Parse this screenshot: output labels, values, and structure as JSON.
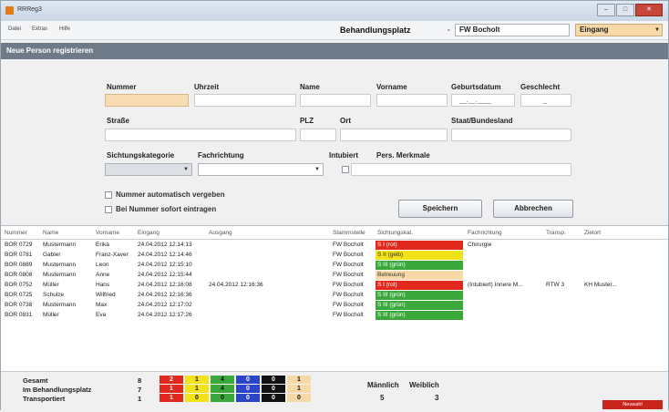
{
  "window": {
    "title": "RRReg3",
    "min": "–",
    "max": "□",
    "close": "✕"
  },
  "menu": {
    "items": [
      "Datei",
      "Extras",
      "Hilfe"
    ]
  },
  "header": {
    "location_label": "Behandlungsplatz",
    "unit": "FW Bocholt",
    "unit_prefix": "- ",
    "view": "Eingang"
  },
  "section": {
    "title": "Neue Person registrieren"
  },
  "form": {
    "labels": {
      "nummer": "Nummer",
      "uhrzeit": "Uhrzeit",
      "name": "Name",
      "vorname": "Vorname",
      "geburtsdatum": "Geburtsdatum",
      "geschlecht": "Geschlecht",
      "strasse": "Straße",
      "plz": "PLZ",
      "ort": "Ort",
      "staat": "Staat/Bundesland",
      "sichtungskategorie": "Sichtungskategorie",
      "fachrichtung": "Fachrichtung",
      "intubiert": "Intubiert",
      "merkmale": "Pers. Merkmale"
    },
    "geburtsdatum_mask": "__.__.____",
    "geschlecht_value": "_",
    "checkbox_auto": "Nummer automatisch vergeben",
    "checkbox_sofort": "Bei Nummer sofort eintragen",
    "save_label": "Speichern",
    "cancel_label": "Abbrechen"
  },
  "table": {
    "columns": [
      "Nummer",
      "Name",
      "Vorname",
      "Eingang",
      "Ausgang",
      "Stammstelle",
      "Sichtungskat.",
      "Fachrichtung",
      "Transp.",
      "Zielort"
    ],
    "rows": [
      [
        "BOR 0729",
        "Mustermann",
        "Erika",
        "24.04.2012 12:14:13",
        "",
        "FW Bocholt",
        "S I (rot)",
        "Chirurgie",
        "",
        ""
      ],
      [
        "BOR 0781",
        "Gabler",
        "Franz-Xaver",
        "24.04.2012 12:14:46",
        "",
        "FW Bocholt",
        "S II (gelb)",
        "",
        "",
        ""
      ],
      [
        "BOR 0889",
        "Mustermann",
        "Leon",
        "24.04.2012 12:15:10",
        "",
        "FW Bocholt",
        "S III (grün)",
        "",
        "",
        ""
      ],
      [
        "BOR 0808",
        "Mustermann",
        "Anne",
        "24.04.2012 12:15:44",
        "",
        "FW Bocholt",
        "Betreuung",
        "",
        "",
        ""
      ],
      [
        "BOR 0752",
        "Müller",
        "Hans",
        "24.04.2012 12:16:08",
        "24.04.2012 12:16:36",
        "FW Bocholt",
        "S I (rot)",
        "(Intubiert) Innere M...",
        "RTW 3",
        "KH Muster..."
      ],
      [
        "BOR 0725",
        "Schulze",
        "Wilfried",
        "24.04.2012 12:16:36",
        "",
        "FW Bocholt",
        "S III (grün)",
        "",
        "",
        ""
      ],
      [
        "BOR 0738",
        "Mustermann",
        "Max",
        "24.04.2012 12:17:02",
        "",
        "FW Bocholt",
        "S III (grün)",
        "",
        "",
        ""
      ],
      [
        "BOR 0831",
        "Müller",
        "Eva",
        "24.04.2012 12:17:26",
        "",
        "FW Bocholt",
        "S III (grün)",
        "",
        "",
        ""
      ]
    ],
    "category_colors": {
      "S I (rot)": "#e0281d",
      "S II (gelb)": "#f2e21a",
      "S III (grün)": "#3aa83a",
      "Betreuung": "#f6d9a6"
    }
  },
  "summary": {
    "rows": [
      {
        "label": "Gesamt",
        "total": "8",
        "cells": [
          "2",
          "1",
          "4",
          "0",
          "0",
          "1"
        ]
      },
      {
        "label": "Im Behandlungsplatz",
        "total": "7",
        "cells": [
          "1",
          "1",
          "4",
          "0",
          "0",
          "1"
        ]
      },
      {
        "label": "Transportiert",
        "total": "1",
        "cells": [
          "1",
          "0",
          "0",
          "0",
          "0",
          "0"
        ]
      }
    ],
    "cell_colors": [
      "#e0281d",
      "#f2e21a",
      "#3aa83a",
      "#2b45c8",
      "#111111",
      "#f6d9a6"
    ],
    "cell_text_colors": [
      "#ffffff",
      "#111111",
      "#111111",
      "#ffffff",
      "#ffffff",
      "#111111"
    ],
    "maennlich_label": "Männlich",
    "weiblich_label": "Weiblich",
    "maennlich": "5",
    "weiblich": "3",
    "new_button": "Neuwahl"
  }
}
